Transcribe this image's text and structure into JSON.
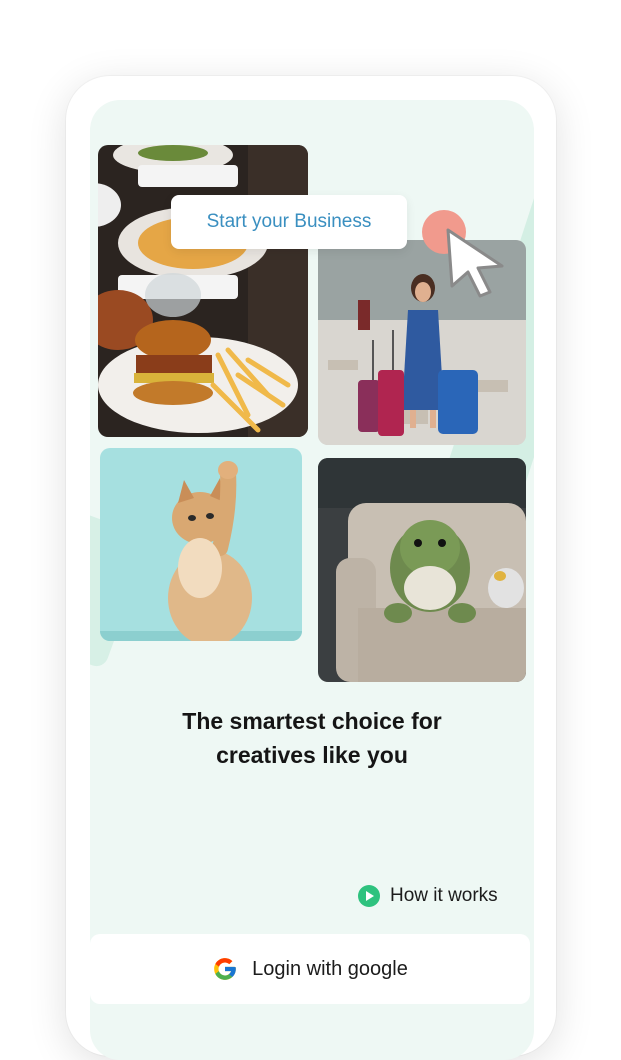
{
  "overlay": {
    "pill_text": "Start your Business"
  },
  "tiles": [
    {
      "name": "food-photo",
      "subject": "burger with fries and plates on restaurant table"
    },
    {
      "name": "travel-photo",
      "subject": "woman with luggage in airport"
    },
    {
      "name": "cat-photo",
      "subject": "ginger kitten reaching up on teal background"
    },
    {
      "name": "plush-photo",
      "subject": "green dinosaur plush on gray sofa"
    }
  ],
  "headline": {
    "line1": "The smartest choice for",
    "line2": "creatives like you"
  },
  "how_it_works": {
    "label": "How it works",
    "icon": "play-circle-icon"
  },
  "login": {
    "label": "Login with google",
    "icon": "google-icon"
  },
  "colors": {
    "screen_bg": "#eef8f4",
    "pill_text": "#3a8fc0",
    "accent_green": "#2ec27e",
    "pointer_dot": "#f19a8d"
  }
}
